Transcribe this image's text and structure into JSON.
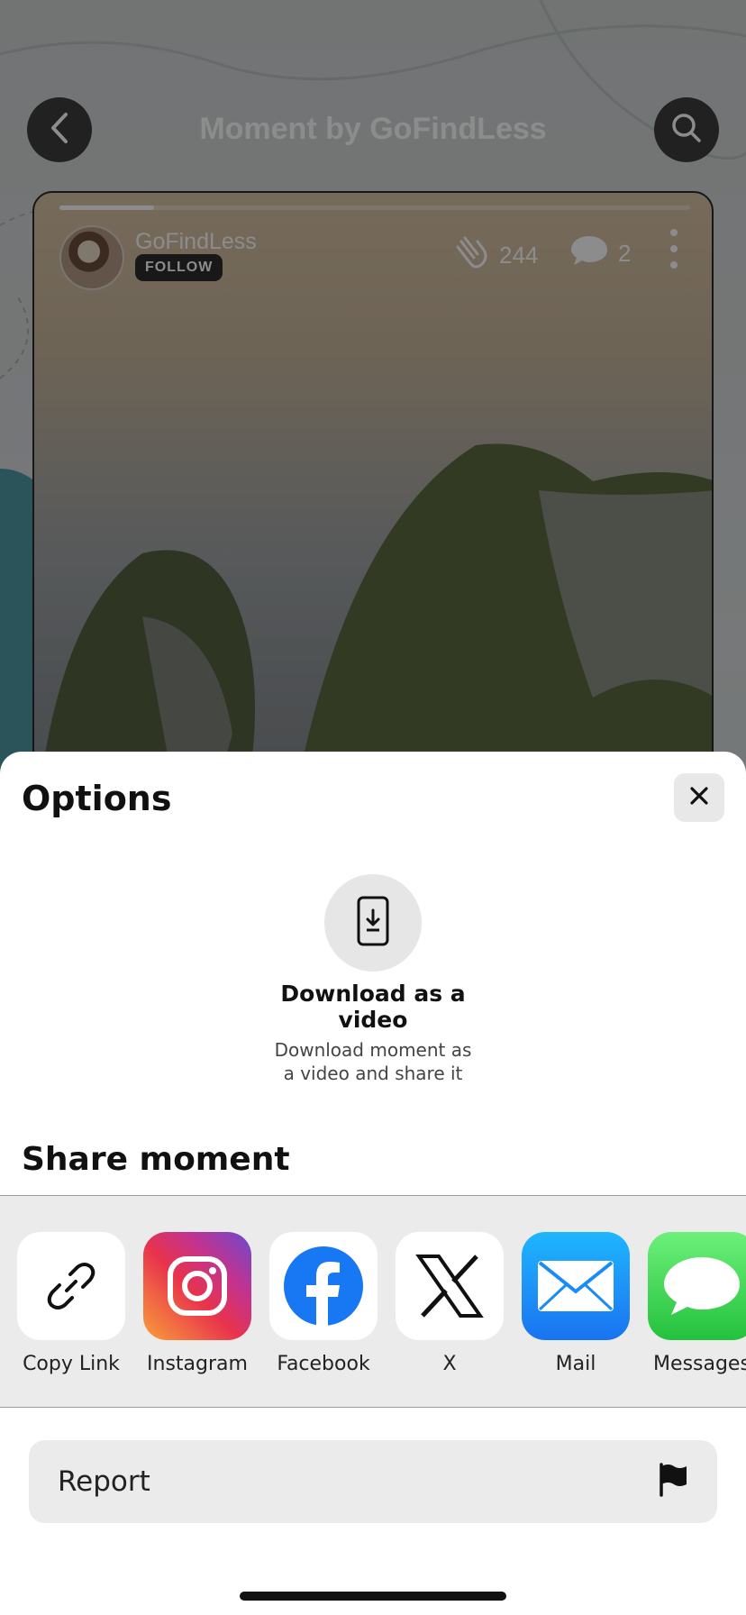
{
  "header": {
    "title": "Moment by GoFindLess",
    "back_icon": "chevron-left-icon",
    "search_icon": "search-icon"
  },
  "moment": {
    "author": "GoFindLess",
    "follow_label": "FOLLOW",
    "claps": "244",
    "comments": "2",
    "progress": 0.15
  },
  "sheet": {
    "title": "Options",
    "download": {
      "title": "Download as a video",
      "description": "Download moment as a video and share it"
    },
    "share_title": "Share moment",
    "share_targets": [
      {
        "label": "Copy Link",
        "icon": "link-icon"
      },
      {
        "label": "Instagram",
        "icon": "instagram-icon"
      },
      {
        "label": "Facebook",
        "icon": "facebook-icon"
      },
      {
        "label": "X",
        "icon": "x-icon"
      },
      {
        "label": "Mail",
        "icon": "mail-icon"
      },
      {
        "label": "Messages",
        "icon": "messages-icon"
      }
    ],
    "report_label": "Report"
  },
  "colors": {
    "facebook": "#1877F2",
    "mail": "#1E90FF",
    "messages": "#34C759",
    "sheet_bg": "#FFFFFF",
    "chip_bg": "#EBEBEB"
  }
}
